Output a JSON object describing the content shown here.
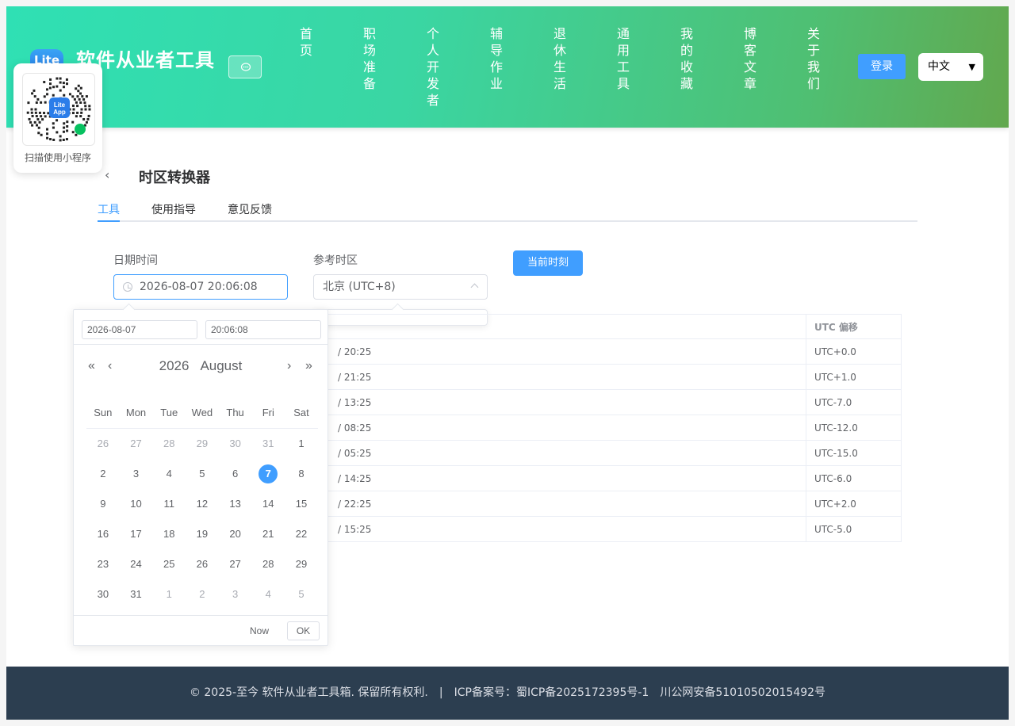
{
  "header": {
    "logo_text": "Lite",
    "site_title": "软件从业者工具",
    "nav": [
      "首页",
      "职场准备",
      "个人开发者",
      "辅导作业",
      "退休生活",
      "通用工具",
      "我的收藏",
      "博客文章",
      "关于我们"
    ],
    "login_label": "登录",
    "language": "中文"
  },
  "qr": {
    "caption": "扫描使用小程序",
    "badge_line1": "Lite",
    "badge_line2": "App"
  },
  "page": {
    "title": "时区转换器",
    "tabs": [
      "工具",
      "使用指导",
      "意见反馈"
    ],
    "active_tab": 0
  },
  "form": {
    "datetime_label": "日期时间",
    "datetime_value": "2026-08-07 20:06:08",
    "tz_label": "参考时区",
    "tz_value": "北京 (UTC+8)",
    "now_button": "当前时刻"
  },
  "table": {
    "offset_header": "UTC 偏移",
    "rows": [
      {
        "time": "/ 20:25",
        "offset": "UTC+0.0"
      },
      {
        "time": "/ 21:25",
        "offset": "UTC+1.0"
      },
      {
        "time": "/ 13:25",
        "offset": "UTC-7.0"
      },
      {
        "time": "/ 08:25",
        "offset": "UTC-12.0"
      },
      {
        "time": "/ 05:25",
        "offset": "UTC-15.0"
      },
      {
        "time": "/ 14:25",
        "offset": "UTC-6.0"
      },
      {
        "time": "/ 22:25",
        "offset": "UTC+2.0"
      },
      {
        "time": "/ 15:25",
        "offset": "UTC-5.0"
      }
    ]
  },
  "picker": {
    "date_value": "2026-08-07",
    "time_value": "20:06:08",
    "year": "2026",
    "month": "August",
    "weekdays": [
      "Sun",
      "Mon",
      "Tue",
      "Wed",
      "Thu",
      "Fri",
      "Sat"
    ],
    "days": [
      {
        "d": "26",
        "m": true
      },
      {
        "d": "27",
        "m": true
      },
      {
        "d": "28",
        "m": true
      },
      {
        "d": "29",
        "m": true
      },
      {
        "d": "30",
        "m": true
      },
      {
        "d": "31",
        "m": true
      },
      {
        "d": "1"
      },
      {
        "d": "2"
      },
      {
        "d": "3"
      },
      {
        "d": "4"
      },
      {
        "d": "5"
      },
      {
        "d": "6"
      },
      {
        "d": "7",
        "s": true
      },
      {
        "d": "8"
      },
      {
        "d": "9"
      },
      {
        "d": "10"
      },
      {
        "d": "11"
      },
      {
        "d": "12"
      },
      {
        "d": "13"
      },
      {
        "d": "14"
      },
      {
        "d": "15"
      },
      {
        "d": "16"
      },
      {
        "d": "17"
      },
      {
        "d": "18"
      },
      {
        "d": "19"
      },
      {
        "d": "20"
      },
      {
        "d": "21"
      },
      {
        "d": "22"
      },
      {
        "d": "23"
      },
      {
        "d": "24"
      },
      {
        "d": "25"
      },
      {
        "d": "26"
      },
      {
        "d": "27"
      },
      {
        "d": "28"
      },
      {
        "d": "29"
      },
      {
        "d": "30"
      },
      {
        "d": "31"
      },
      {
        "d": "1",
        "m": true
      },
      {
        "d": "2",
        "m": true
      },
      {
        "d": "3",
        "m": true
      },
      {
        "d": "4",
        "m": true
      },
      {
        "d": "5",
        "m": true
      }
    ],
    "now_label": "Now",
    "ok_label": "OK"
  },
  "footer": {
    "copyright": "© 2025-至今 软件从业者工具箱. 保留所有权利.",
    "separator": "|",
    "icp": "ICP备案号：蜀ICP备2025172395号-1",
    "police": "川公网安备51010502015492号"
  },
  "colors": {
    "primary": "#409eff",
    "footer_bg": "#2c3e50",
    "header_start": "#2fe0b4",
    "header_end": "#62a84e"
  }
}
